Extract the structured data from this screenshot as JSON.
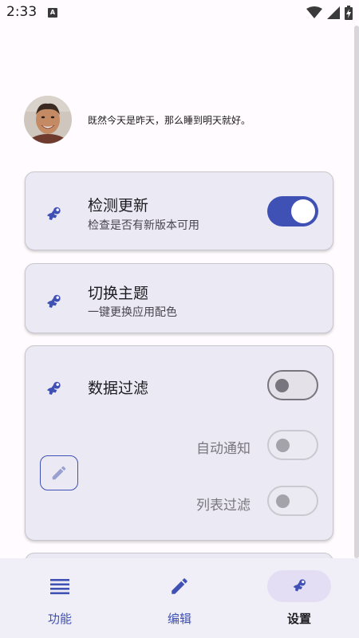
{
  "status_bar": {
    "time": "2:33",
    "notification_letter": "A"
  },
  "profile": {
    "motto": "既然今天是昨天，那么睡到明天就好。"
  },
  "settings": {
    "check_update": {
      "title": "检测更新",
      "subtitle": "检查是否有新版本可用",
      "enabled": true
    },
    "switch_theme": {
      "title": "切换主题",
      "subtitle": "一键更换应用配色"
    },
    "data_filter": {
      "title": "数据过滤",
      "enabled": false,
      "auto_notify_label": "自动通知",
      "list_filter_label": "列表过滤"
    }
  },
  "bottom_nav": [
    {
      "label": "功能",
      "icon": "list-icon"
    },
    {
      "label": "编辑",
      "icon": "pencil-icon"
    },
    {
      "label": "设置",
      "icon": "settings-tool-icon",
      "active": true
    }
  ],
  "colors": {
    "primary": "#3f51b5",
    "card": "#ebe9f4",
    "nav_active": "#e4def5"
  }
}
